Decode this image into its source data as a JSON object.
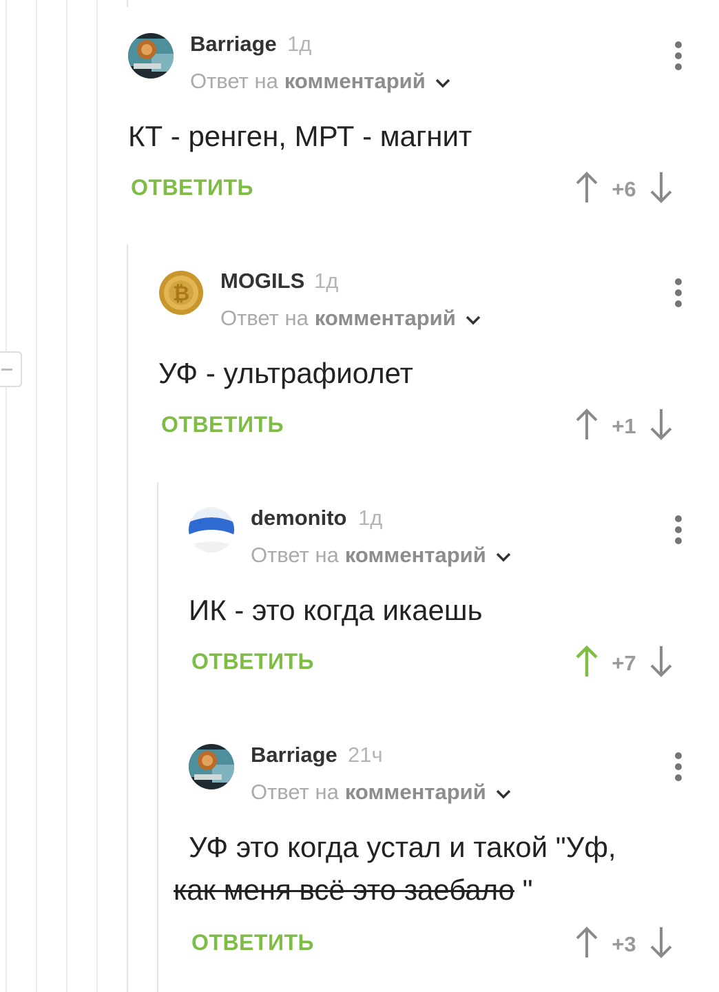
{
  "labels": {
    "reply_to_prefix": "Ответ на",
    "reply_to_link": "комментарий",
    "reply_button": "ОТВЕТИТЬ"
  },
  "colors": {
    "accent_green": "#7ebc46",
    "upvote_active": "#7ebc46",
    "arrow_default": "#8a8a8a"
  },
  "comments": [
    {
      "author": "Barriage",
      "time": "1д",
      "text": "КТ - ренген,  МРТ - магнит",
      "score": "+6",
      "upvoted": false,
      "avatar_icon": "lion-avatar"
    },
    {
      "author": "MOGILS",
      "time": "1д",
      "text": "УФ - ультрафиолет",
      "score": "+1",
      "upvoted": false,
      "avatar_icon": "bitcoin-avatar"
    },
    {
      "author": "demonito",
      "time": "1д",
      "text": "ИК - это когда икаешь",
      "score": "+7",
      "upvoted": true,
      "avatar_icon": "flag-avatar"
    },
    {
      "author": "Barriage",
      "time": "21ч",
      "text_line1": "УФ это когда устал и такой \"Уф,",
      "text_line2_strike": "как меня всё это заебало",
      "text_line2_tail": " \"",
      "score": "+3",
      "upvoted": false,
      "avatar_icon": "lion-avatar"
    }
  ]
}
